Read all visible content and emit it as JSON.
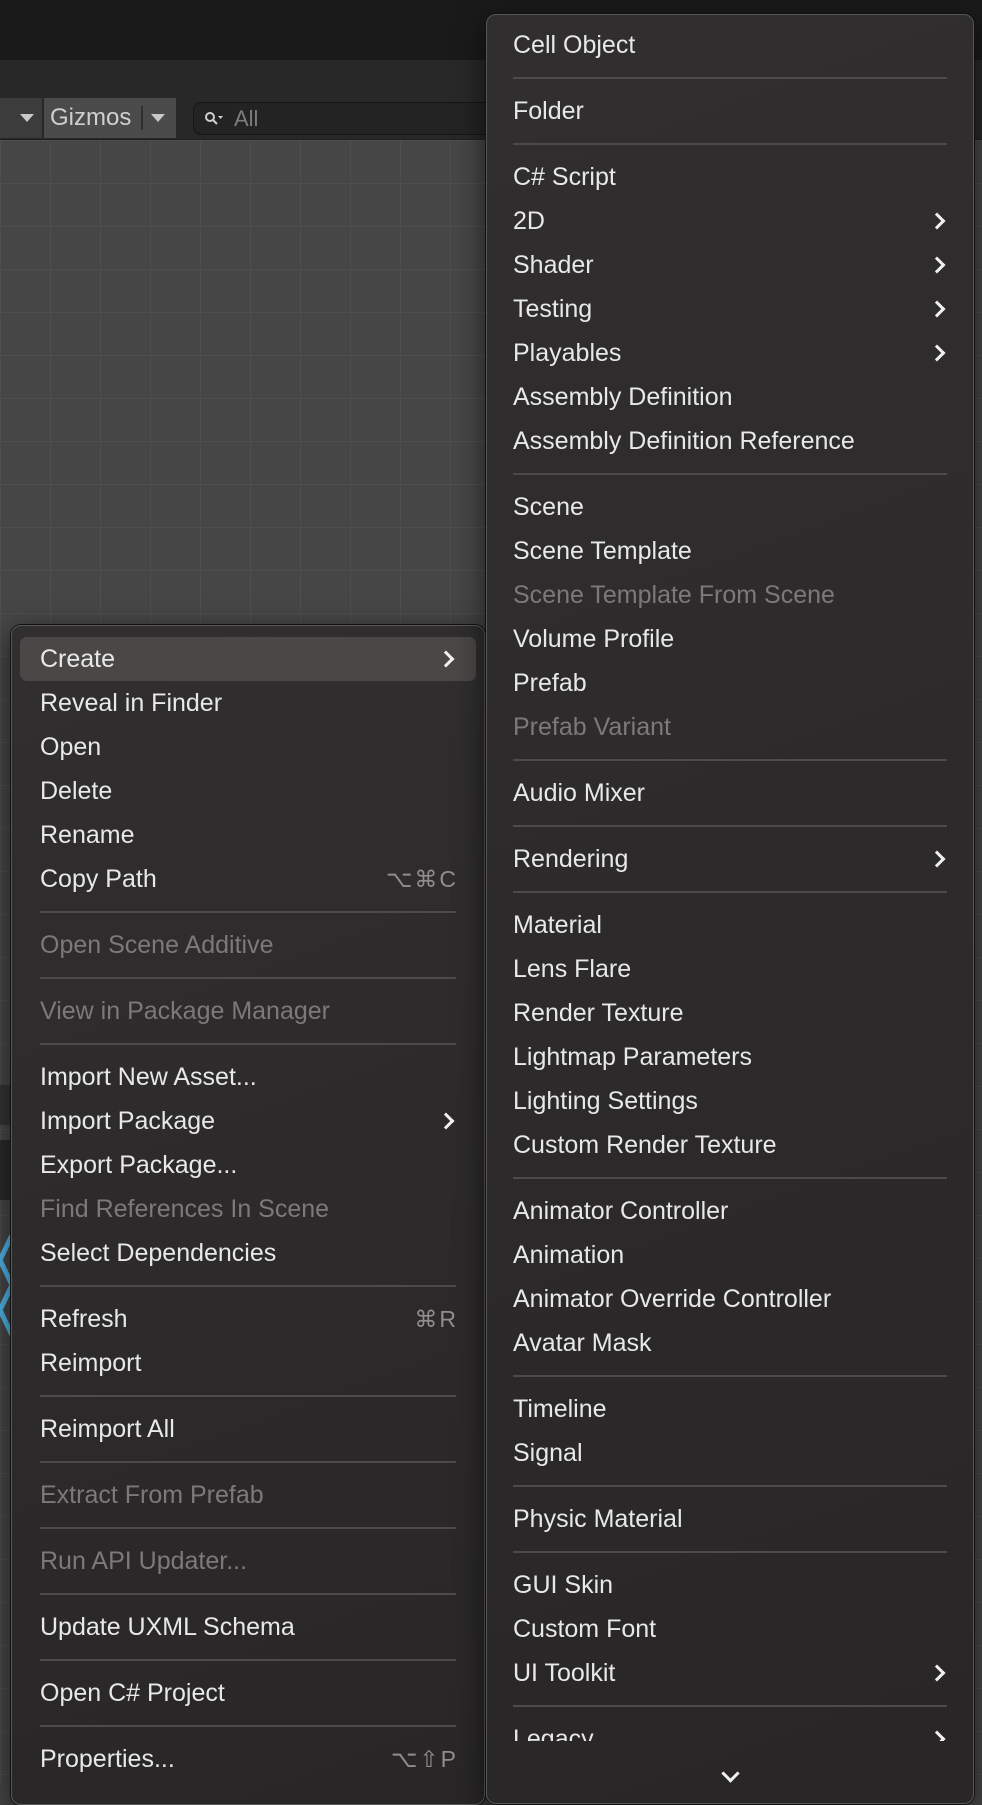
{
  "toolbar": {
    "gizmos_label": "Gizmos",
    "search_placeholder": "All"
  },
  "left_menu": [
    {
      "type": "item",
      "label": "Create",
      "submenu": true,
      "highlighted": true
    },
    {
      "type": "item",
      "label": "Reveal in Finder"
    },
    {
      "type": "item",
      "label": "Open"
    },
    {
      "type": "item",
      "label": "Delete"
    },
    {
      "type": "item",
      "label": "Rename"
    },
    {
      "type": "item",
      "label": "Copy Path",
      "shortcut": "⌥⌘C"
    },
    {
      "type": "sep"
    },
    {
      "type": "item",
      "label": "Open Scene Additive",
      "disabled": true
    },
    {
      "type": "sep"
    },
    {
      "type": "item",
      "label": "View in Package Manager",
      "disabled": true
    },
    {
      "type": "sep"
    },
    {
      "type": "item",
      "label": "Import New Asset..."
    },
    {
      "type": "item",
      "label": "Import Package",
      "submenu": true
    },
    {
      "type": "item",
      "label": "Export Package..."
    },
    {
      "type": "item",
      "label": "Find References In Scene",
      "disabled": true
    },
    {
      "type": "item",
      "label": "Select Dependencies"
    },
    {
      "type": "sep"
    },
    {
      "type": "item",
      "label": "Refresh",
      "shortcut": "⌘R"
    },
    {
      "type": "item",
      "label": "Reimport"
    },
    {
      "type": "sep"
    },
    {
      "type": "item",
      "label": "Reimport All"
    },
    {
      "type": "sep"
    },
    {
      "type": "item",
      "label": "Extract From Prefab",
      "disabled": true
    },
    {
      "type": "sep"
    },
    {
      "type": "item",
      "label": "Run API Updater...",
      "disabled": true
    },
    {
      "type": "sep"
    },
    {
      "type": "item",
      "label": "Update UXML Schema"
    },
    {
      "type": "sep"
    },
    {
      "type": "item",
      "label": "Open C# Project"
    },
    {
      "type": "sep"
    },
    {
      "type": "item",
      "label": "Properties...",
      "shortcut": "⌥⇧P"
    }
  ],
  "right_menu": [
    {
      "type": "item",
      "label": "Cell Object"
    },
    {
      "type": "sep"
    },
    {
      "type": "item",
      "label": "Folder"
    },
    {
      "type": "sep"
    },
    {
      "type": "item",
      "label": "C# Script"
    },
    {
      "type": "item",
      "label": "2D",
      "submenu": true
    },
    {
      "type": "item",
      "label": "Shader",
      "submenu": true
    },
    {
      "type": "item",
      "label": "Testing",
      "submenu": true
    },
    {
      "type": "item",
      "label": "Playables",
      "submenu": true
    },
    {
      "type": "item",
      "label": "Assembly Definition"
    },
    {
      "type": "item",
      "label": "Assembly Definition Reference"
    },
    {
      "type": "sep"
    },
    {
      "type": "item",
      "label": "Scene"
    },
    {
      "type": "item",
      "label": "Scene Template"
    },
    {
      "type": "item",
      "label": "Scene Template From Scene",
      "disabled": true
    },
    {
      "type": "item",
      "label": "Volume Profile"
    },
    {
      "type": "item",
      "label": "Prefab"
    },
    {
      "type": "item",
      "label": "Prefab Variant",
      "disabled": true
    },
    {
      "type": "sep"
    },
    {
      "type": "item",
      "label": "Audio Mixer"
    },
    {
      "type": "sep"
    },
    {
      "type": "item",
      "label": "Rendering",
      "submenu": true
    },
    {
      "type": "sep"
    },
    {
      "type": "item",
      "label": "Material"
    },
    {
      "type": "item",
      "label": "Lens Flare"
    },
    {
      "type": "item",
      "label": "Render Texture"
    },
    {
      "type": "item",
      "label": "Lightmap Parameters"
    },
    {
      "type": "item",
      "label": "Lighting Settings"
    },
    {
      "type": "item",
      "label": "Custom Render Texture"
    },
    {
      "type": "sep"
    },
    {
      "type": "item",
      "label": "Animator Controller"
    },
    {
      "type": "item",
      "label": "Animation"
    },
    {
      "type": "item",
      "label": "Animator Override Controller"
    },
    {
      "type": "item",
      "label": "Avatar Mask"
    },
    {
      "type": "sep"
    },
    {
      "type": "item",
      "label": "Timeline"
    },
    {
      "type": "item",
      "label": "Signal"
    },
    {
      "type": "sep"
    },
    {
      "type": "item",
      "label": "Physic Material"
    },
    {
      "type": "sep"
    },
    {
      "type": "item",
      "label": "GUI Skin"
    },
    {
      "type": "item",
      "label": "Custom Font"
    },
    {
      "type": "item",
      "label": "UI Toolkit",
      "submenu": true
    },
    {
      "type": "sep"
    },
    {
      "type": "item",
      "label": "Legacy",
      "submenu": true
    }
  ],
  "icons": {
    "search": "search-icon",
    "submenu": "chevron-right-icon",
    "scroll": "chevron-down-icon"
  }
}
